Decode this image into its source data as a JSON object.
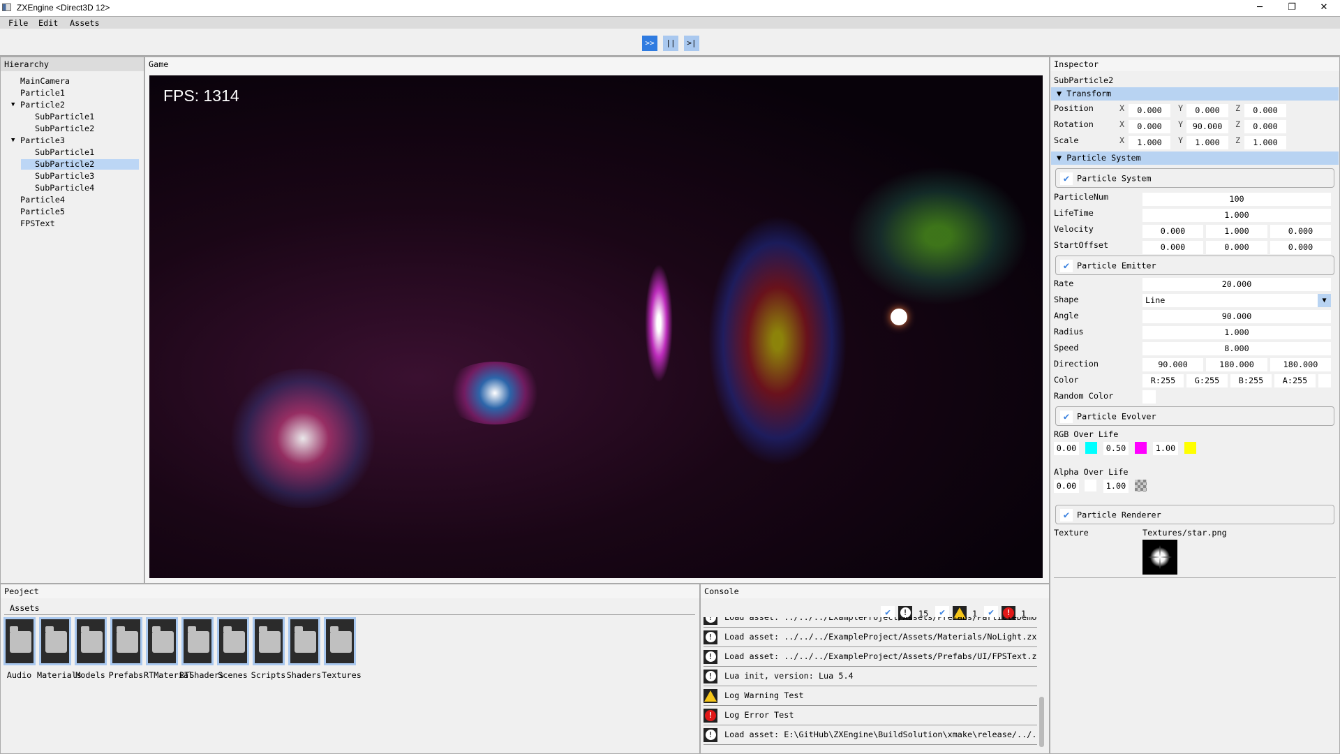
{
  "window": {
    "title": "ZXEngine <Direct3D 12>",
    "minimize": "─",
    "maximize": "❐",
    "close": "✕"
  },
  "menu": [
    "File",
    "Edit",
    "Assets"
  ],
  "toolbar": {
    "play": ">>",
    "pause": "||",
    "step": ">|"
  },
  "hierarchy": {
    "title": "Hierarchy",
    "items": [
      {
        "label": "MainCamera",
        "depth": 0
      },
      {
        "label": "Particle1",
        "depth": 0
      },
      {
        "label": "Particle2",
        "depth": 0,
        "expanded": true
      },
      {
        "label": "SubParticle1",
        "depth": 1
      },
      {
        "label": "SubParticle2",
        "depth": 1
      },
      {
        "label": "Particle3",
        "depth": 0,
        "expanded": true
      },
      {
        "label": "SubParticle1",
        "depth": 1
      },
      {
        "label": "SubParticle2",
        "depth": 1,
        "selected": true
      },
      {
        "label": "SubParticle3",
        "depth": 1
      },
      {
        "label": "SubParticle4",
        "depth": 1
      },
      {
        "label": "Particle4",
        "depth": 0
      },
      {
        "label": "Particle5",
        "depth": 0
      },
      {
        "label": "FPSText",
        "depth": 0
      }
    ]
  },
  "game": {
    "title": "Game",
    "fps_text": "FPS: 1314"
  },
  "inspector": {
    "title": "Inspector",
    "object_name": "SubParticle2",
    "transform": {
      "header": "Transform",
      "axes": [
        "X",
        "Y",
        "Z"
      ],
      "rows": [
        {
          "label": "Position",
          "values": [
            "0.000",
            "0.000",
            "0.000"
          ]
        },
        {
          "label": "Rotation",
          "values": [
            "0.000",
            "90.000",
            "0.000"
          ]
        },
        {
          "label": "Scale",
          "values": [
            "1.000",
            "1.000",
            "1.000"
          ]
        }
      ]
    },
    "particle_system": {
      "header": "Particle System",
      "system": {
        "label": "Particle System",
        "enabled": true,
        "fields": [
          {
            "label": "ParticleNum",
            "values": [
              "100"
            ]
          },
          {
            "label": "LifeTime",
            "values": [
              "1.000"
            ]
          },
          {
            "label": "Velocity",
            "values": [
              "0.000",
              "1.000",
              "0.000"
            ]
          },
          {
            "label": "StartOffset",
            "values": [
              "0.000",
              "0.000",
              "0.000"
            ]
          }
        ]
      },
      "emitter": {
        "label": "Particle Emitter",
        "enabled": true,
        "rate_label": "Rate",
        "rate": "20.000",
        "shape_label": "Shape",
        "shape": "Line",
        "angle_label": "Angle",
        "angle": "90.000",
        "radius_label": "Radius",
        "radius": "1.000",
        "speed_label": "Speed",
        "speed": "8.000",
        "direction_label": "Direction",
        "direction": [
          "90.000",
          "180.000",
          "180.000"
        ],
        "color_label": "Color",
        "color": [
          "R:255",
          "G:255",
          "B:255",
          "A:255"
        ],
        "random_color_label": "Random Color",
        "random_color": false
      },
      "evolver": {
        "label": "Particle Evolver",
        "enabled": true,
        "rgb_label": "RGB Over Life",
        "rgb_keys": [
          {
            "t": "0.00",
            "color": "#00ffff"
          },
          {
            "t": "0.50",
            "color": "#ff00ff"
          },
          {
            "t": "1.00",
            "color": "#ffff00"
          }
        ],
        "alpha_label": "Alpha Over Life",
        "alpha_keys": [
          {
            "t": "0.00"
          },
          {
            "t": "1.00"
          }
        ]
      },
      "renderer": {
        "label": "Particle Renderer",
        "enabled": true,
        "texture_label": "Texture",
        "texture": "Textures/star.png"
      }
    }
  },
  "project": {
    "title": "Peoject",
    "tab": "Assets",
    "folders": [
      "Audio",
      "Materials",
      "Models",
      "Prefabs",
      "RTMaterial",
      "RTShaders",
      "Scenes",
      "Scripts",
      "Shaders",
      "Textures"
    ]
  },
  "console": {
    "title": "Console",
    "counts": {
      "info": "15",
      "warning": "1",
      "error": "1"
    },
    "logs": [
      {
        "type": "info",
        "text": "Load asset: ../../../ExampleProject/Assets/Prefabs/ParticleDemo/"
      },
      {
        "type": "info",
        "text": "Load asset: ../../../ExampleProject/Assets/Materials/NoLight.zxm"
      },
      {
        "type": "info",
        "text": "Load asset: ../../../ExampleProject/Assets/Prefabs/UI/FPSText.zx"
      },
      {
        "type": "info",
        "text": "Lua init, version: Lua 5.4"
      },
      {
        "type": "warning",
        "text": "Log Warning Test"
      },
      {
        "type": "error",
        "text": "Log Error Test"
      },
      {
        "type": "info",
        "text": "Load asset: E:\\GitHub\\ZXEngine\\BuildSolution\\xmake\\release/../.."
      }
    ]
  },
  "colors": {
    "accent": "#2f7be0",
    "selection": "#bcd6f5",
    "header_band": "#b8d3f2"
  }
}
